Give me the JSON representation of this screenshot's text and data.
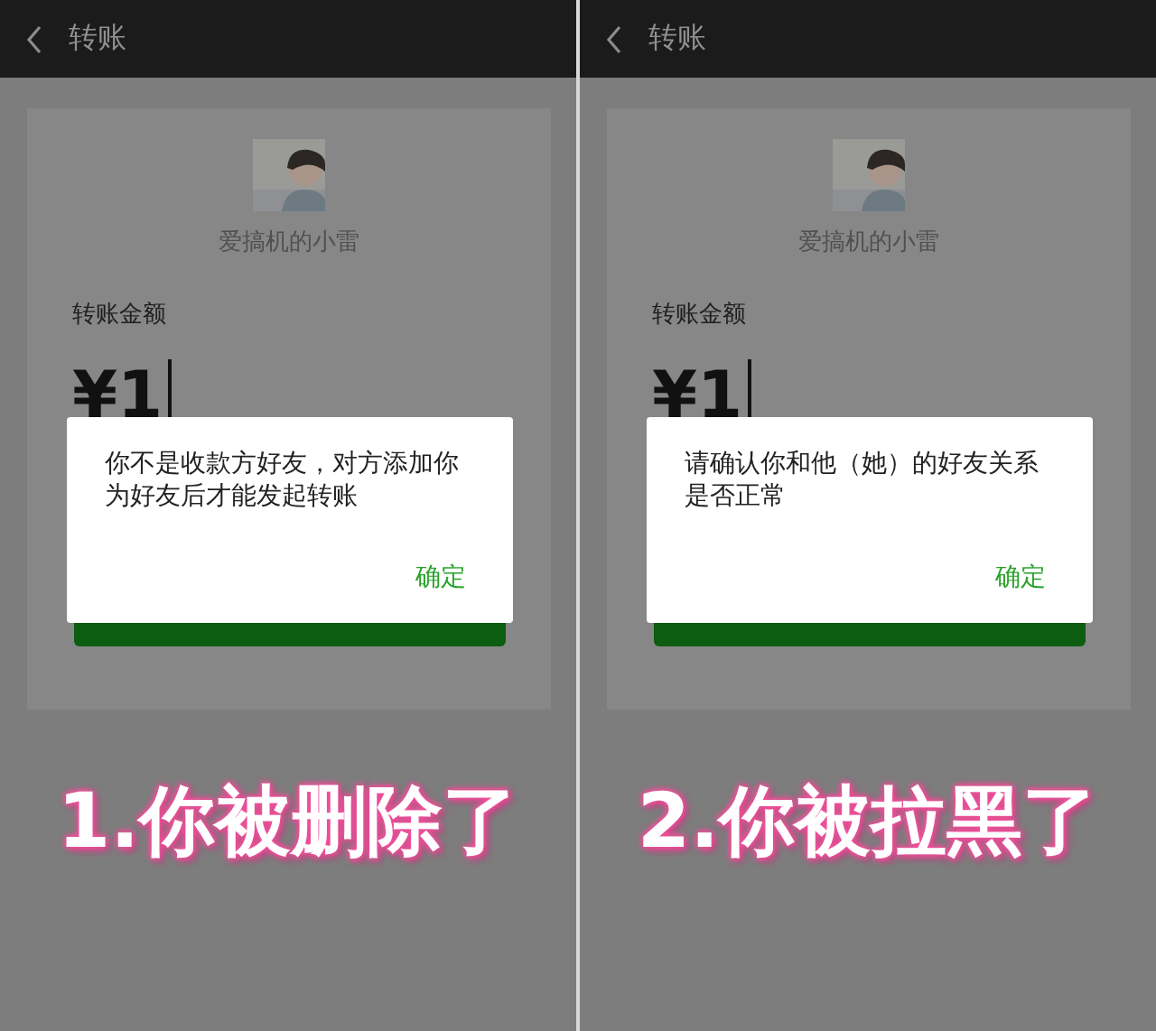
{
  "panels": [
    {
      "nav": {
        "title": "转账"
      },
      "payee": {
        "name": "爱搞机的小雷"
      },
      "amount_label": "转账金额",
      "amount": "¥1",
      "dialog": {
        "message": "你不是收款方好友，对方添加你为好友后才能发起转账",
        "button": "确定"
      },
      "caption": "1.你被删除了"
    },
    {
      "nav": {
        "title": "转账"
      },
      "payee": {
        "name": "爱搞机的小雷"
      },
      "amount_label": "转账金额",
      "amount": "¥1",
      "dialog": {
        "message": "请确认你和他（她）的好友关系是否正常",
        "button": "确定"
      },
      "caption": "2.你被拉黑了"
    }
  ]
}
